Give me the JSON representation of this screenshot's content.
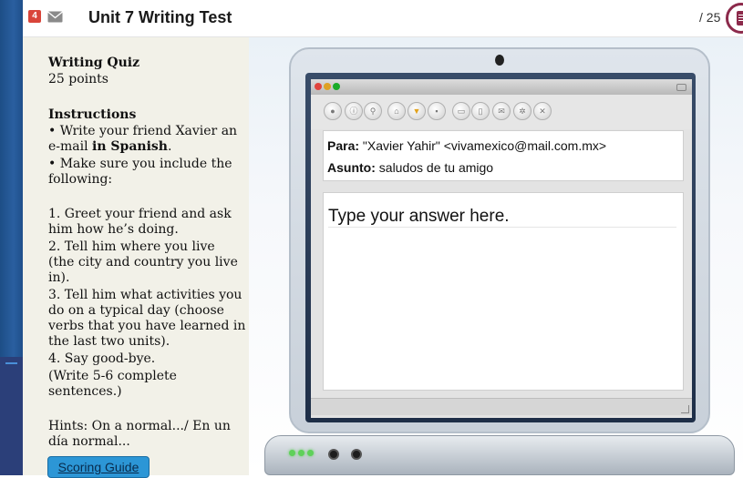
{
  "header": {
    "badge_count": "4",
    "title": "Unit 7 Writing Test",
    "score": "/ 25"
  },
  "instructions": {
    "quiz_title": "Writing Quiz",
    "points": "25 points",
    "heading": "Instructions",
    "bullet1_a": "• Write your friend Xavier an",
    "bullet1_b": "e-mail ",
    "bullet1_bold": "in Spanish",
    "bullet1_end": ".",
    "bullet2_a": "• Make sure you include the",
    "bullet2_b": "following:",
    "item1_a": "1. Greet your friend and ask",
    "item1_b": "him how he’s doing.",
    "item2_a": "2. Tell him where you live",
    "item2_b": "(the city and country you live",
    "item2_c": "in).",
    "item3_a": "3. Tell him what activities you",
    "item3_b": "do on a typical day (choose",
    "item3_c": "verbs that you have learned in",
    "item3_d": "the last two units).",
    "item4": "4. Say good-bye.",
    "note_a": "(Write 5-6 complete",
    "note_b": "sentences.)",
    "hints_a": "Hints: On a normal.../ En un",
    "hints_b": "día normal...",
    "scoring_button": "Scoring Guide"
  },
  "email": {
    "to_label": "Para:",
    "to_value": " \"Xavier Yahir\" <vivamexico@mail.com.mx>",
    "subject_label": "Asunto:",
    "subject_value": " saludos de tu amigo",
    "answer_placeholder": "Type your answer here.",
    "answer_value": ""
  },
  "toolbar_icons": [
    "back-icon",
    "info-icon",
    "search-icon",
    "home-icon",
    "favorite-icon",
    "bookmark-icon",
    "print-icon",
    "document-icon",
    "attach-icon",
    "settings-icon",
    "close-icon"
  ],
  "colors": {
    "badge": "#d9453a",
    "menu_accent": "#8c2a4b",
    "scoring_button": "#2c96d6",
    "panel_bg": "#f2f1e8",
    "window_close": "#e0443e",
    "window_minimize": "#dea123",
    "window_zoom": "#1aab29",
    "power_light": "#5fd15a"
  }
}
